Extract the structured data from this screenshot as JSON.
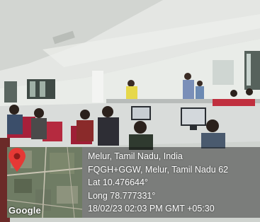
{
  "photo": {
    "location_title": "Melur, Tamil Nadu, India",
    "address": "FQGH+GGW, Melur, Tamil Nadu 62",
    "lat": "Lat 10.476644°",
    "long": "Long 78.777331°",
    "datetime": "18/02/23 02:03 PM GMT +05:30",
    "map_brand": "Google"
  },
  "colors": {
    "pin": "#e53935",
    "overlay": "rgba(20,20,20,0.45)",
    "text": "#ffffff"
  }
}
